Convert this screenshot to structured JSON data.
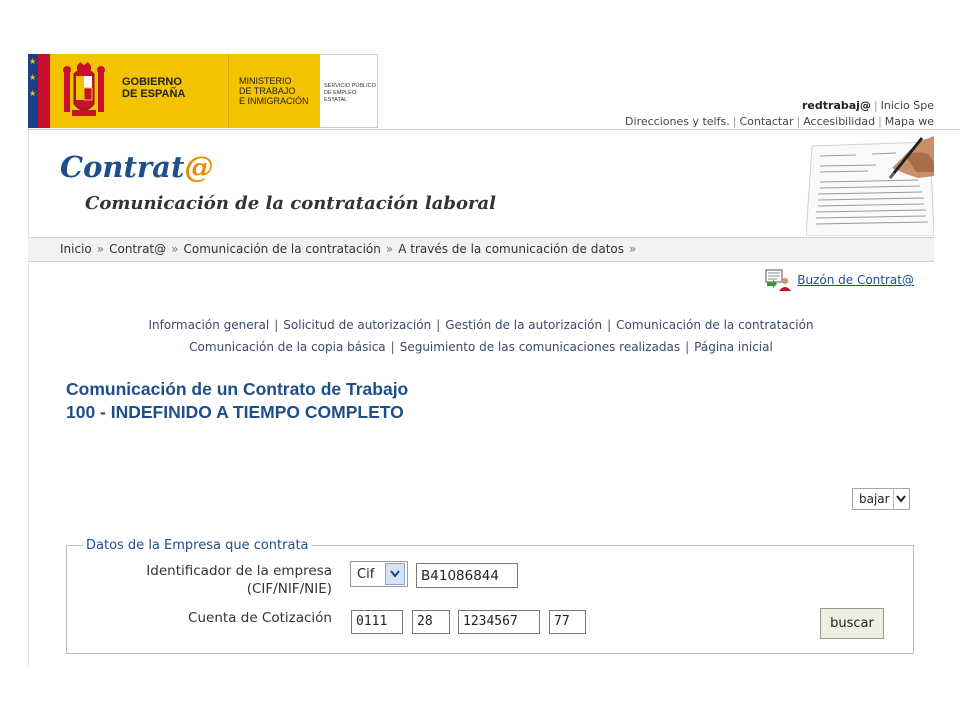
{
  "header": {
    "gobierno_line1": "GOBIERNO",
    "gobierno_line2": "DE ESPAÑA",
    "ministerio_line1": "MINISTERIO",
    "ministerio_line2": "DE TRABAJO",
    "ministerio_line3": "E INMIGRACIÓN",
    "sepe_line1": "SERVICIO PÚBLICO",
    "sepe_line2": "DE EMPLEO ESTATAL",
    "top_user": "redtrabaj@",
    "top_inicio": "Inicio Spe",
    "top_direcciones": "Direcciones y telfs.",
    "top_contactar": "Contactar",
    "top_accesibilidad": "Accesibilidad",
    "top_mapa": "Mapa we"
  },
  "brand": {
    "name": "Contrat",
    "at": "@",
    "subtitle": "Comunicación de la contratación laboral"
  },
  "breadcrumb": {
    "items": [
      "Inicio",
      "Contrat@",
      "Comunicación de la contratación",
      "A través de la comunicación de datos"
    ],
    "separator": "»"
  },
  "mailbox": {
    "label": "Buzón de Contrat@"
  },
  "nav": {
    "informacion": "Información general",
    "solicitud": "Solicitud de autorización",
    "gestion": "Gestión de la autorización",
    "comunicacion": "Comunicación de la contratación",
    "copia": "Comunicación de la copia básica",
    "seguimiento": "Seguimiento de las comunicaciones realizadas",
    "inicial": "Página inicial",
    "separator": "|"
  },
  "main": {
    "title_line1": "Comunicación de un Contrato de Trabajo",
    "title_line2": "100 - INDEFINIDO A TIEMPO COMPLETO",
    "bajar_label": "bajar"
  },
  "form": {
    "legend": "Datos de la Empresa que contrata",
    "id_label_line1": "Identificador de la empresa",
    "id_label_line2": "(CIF/NIF/NIE)",
    "id_type_selected": "Cif",
    "id_value": "B41086844",
    "cuenta_label": "Cuenta de Cotización",
    "cuenta_1": "0111",
    "cuenta_2": "28",
    "cuenta_3": "1234567",
    "cuenta_4": "77",
    "buscar_label": "buscar"
  },
  "colors": {
    "link_blue": "#1f4e8c",
    "brand_orange": "#e88b00",
    "gov_yellow": "#f3c300"
  },
  "icons": {
    "mailbox": "mailbox-icon",
    "crest": "coat-of-arms-icon",
    "dropdown": "chevron-down-icon"
  }
}
